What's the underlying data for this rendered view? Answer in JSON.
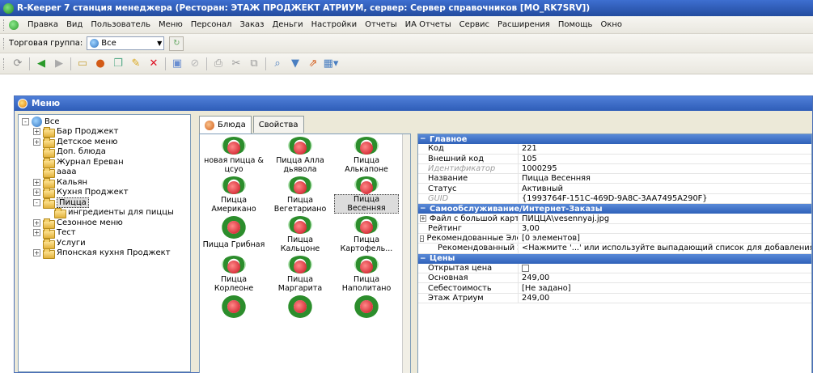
{
  "title": "R-Keeper 7 станция менеджера (Ресторан: ЭТАЖ ПРОДЖЕКТ АТРИУМ, сервер: Сервер справочников [MO_RK7SRV])",
  "menubar": [
    "Правка",
    "Вид",
    "Пользователь",
    "Меню",
    "Персонал",
    "Заказ",
    "Деньги",
    "Настройки",
    "Отчеты",
    "ИА Отчеты",
    "Сервис",
    "Расширения",
    "Помощь",
    "Окно"
  ],
  "toolbar1": {
    "label": "Торговая группа:",
    "combo_value": "Все"
  },
  "child": {
    "title": "Меню"
  },
  "tree": [
    {
      "label": "Все",
      "depth": 0,
      "icon": "globe",
      "expander": "-"
    },
    {
      "label": "Бар Проджект",
      "depth": 1,
      "icon": "folder",
      "expander": "+"
    },
    {
      "label": "Детское меню",
      "depth": 1,
      "icon": "folder",
      "expander": "+"
    },
    {
      "label": "Доп. блюда",
      "depth": 1,
      "icon": "folder",
      "expander": ""
    },
    {
      "label": "Журнал Ереван",
      "depth": 1,
      "icon": "folder",
      "expander": ""
    },
    {
      "label": "аааа",
      "depth": 1,
      "icon": "folder",
      "expander": ""
    },
    {
      "label": "Кальян",
      "depth": 1,
      "icon": "folder",
      "expander": "+"
    },
    {
      "label": "Кухня Проджект",
      "depth": 1,
      "icon": "folder",
      "expander": "+"
    },
    {
      "label": "Пицца",
      "depth": 1,
      "icon": "folder",
      "expander": "-",
      "selected": true
    },
    {
      "label": "ингредиенты для пиццы",
      "depth": 2,
      "icon": "folder",
      "expander": ""
    },
    {
      "label": "Сезонное меню",
      "depth": 1,
      "icon": "folder",
      "expander": "+"
    },
    {
      "label": "Тест",
      "depth": 1,
      "icon": "folder",
      "expander": "+"
    },
    {
      "label": "Услуги",
      "depth": 1,
      "icon": "folder",
      "expander": ""
    },
    {
      "label": "Японская кухня Проджект",
      "depth": 1,
      "icon": "folder",
      "expander": "+"
    }
  ],
  "tabs": [
    {
      "label": "Блюда",
      "icon": "plate-icon",
      "active": true
    },
    {
      "label": "Свойства",
      "icon": "properties-icon",
      "active": false
    }
  ],
  "dishes": [
    {
      "label": "новая пицца & цсуо"
    },
    {
      "label": "Пицца Алла дьявола"
    },
    {
      "label": "Пицца Алькапоне"
    },
    {
      "label": "Пицца Американо"
    },
    {
      "label": "Пицца Вегетариано"
    },
    {
      "label": "Пицца Весенняя",
      "selected": true
    },
    {
      "label": "Пицца Грибная"
    },
    {
      "label": "Пицца Кальцоне"
    },
    {
      "label": "Пицца Картофель..."
    },
    {
      "label": "Пицца Корлеоне"
    },
    {
      "label": "Пицца Маргарита"
    },
    {
      "label": "Пицца Наполитано"
    },
    {
      "label": ""
    },
    {
      "label": ""
    },
    {
      "label": ""
    }
  ],
  "properties": [
    {
      "type": "cat",
      "name": "Главное"
    },
    {
      "type": "row",
      "name": "Код",
      "value": "221"
    },
    {
      "type": "row",
      "name": "Внешний код",
      "value": "105"
    },
    {
      "type": "row",
      "name": "Идентификатор",
      "value": "1000295",
      "disabled": true
    },
    {
      "type": "row",
      "name": "Название",
      "value": "Пицца Весенняя"
    },
    {
      "type": "row",
      "name": "Статус",
      "value": "Активный"
    },
    {
      "type": "row",
      "name": "GUID",
      "value": "{1993764F-151C-469D-9A8C-3AA7495A290F}",
      "disabled": true
    },
    {
      "type": "cat",
      "name": "Самообслуживание/Интернет-Заказы"
    },
    {
      "type": "row",
      "name": "Файл с большой карти",
      "value": "ПИЦЦА\\vesennyaj.jpg",
      "expander": "+"
    },
    {
      "type": "row",
      "name": "Рейтинг",
      "value": "3,00"
    },
    {
      "type": "row",
      "name": "Рекомендованные Эле",
      "value": "[0 элементов]",
      "expander": "-"
    },
    {
      "type": "row",
      "name": "Рекомендованный Э",
      "value": "<Нажмите '...' или используйте выпадающий список для добавления элемента",
      "indent": true
    },
    {
      "type": "cat",
      "name": "Цены"
    },
    {
      "type": "row",
      "name": "Открытая цена",
      "value": "",
      "checkbox": true
    },
    {
      "type": "row",
      "name": "Основная",
      "value": "249,00"
    },
    {
      "type": "row",
      "name": "Себестоимость",
      "value": "[Не задано]"
    },
    {
      "type": "row",
      "name": "Этаж Атриум",
      "value": "249,00"
    }
  ]
}
